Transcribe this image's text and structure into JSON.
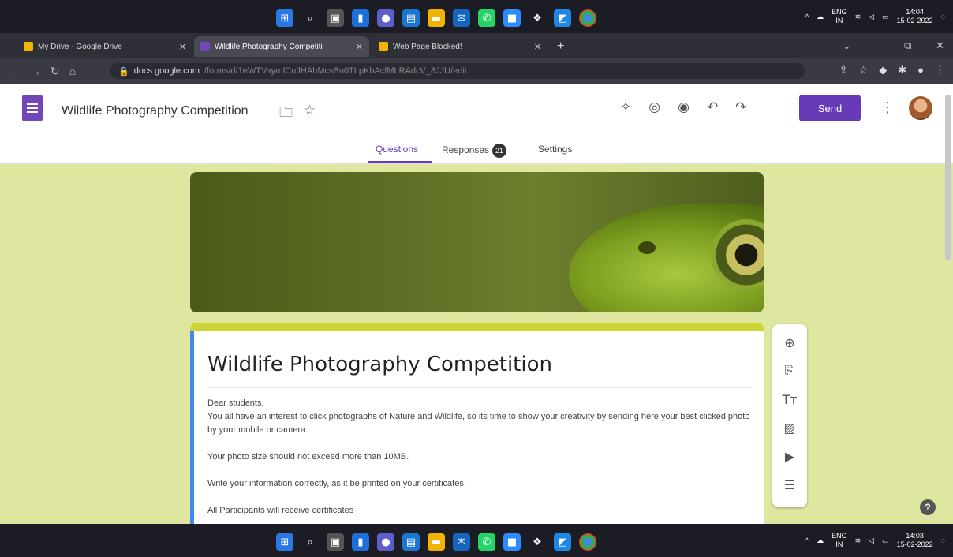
{
  "browser": {
    "tabs": [
      {
        "label": "My Drive - Google Drive",
        "color": "#f2b400"
      },
      {
        "label": "Wildlife Photography Competiti",
        "color": "#7248b9"
      },
      {
        "label": "Web Page Blocked!",
        "color": "#f2b400"
      }
    ],
    "url_host": "docs.google.com",
    "url_path": "/forms/d/1eWTVayrnlCuJHAhMcsBu0TLpKbAcfMLRAdcV_8JJU/edit"
  },
  "form_header": {
    "doc_title": "Wildlife Photography Competition",
    "send_label": "Send",
    "tabs": [
      "Questions",
      "Responses",
      "Settings"
    ],
    "responses_count": "21"
  },
  "form": {
    "title": "Wildlife Photography Competition",
    "description": [
      "Dear students,",
      "You all have an interest to click photographs of Nature and Wildlife, so its time to show your creativity by sending here your best clicked photo by your mobile or camera.",
      "Your photo size should not exceed more than 10MB.",
      "Write your information correctly, as it be printed on your certificates.",
      "All Participants will receive certificates"
    ]
  },
  "system_tray": {
    "lang": "ENG",
    "region": "IN",
    "time_top": "14:04",
    "date_top": "15-02-2022",
    "time_bottom": "14:03",
    "date_bottom": "15-02-2022"
  },
  "colors": {
    "accent": "#673ab7",
    "page_background": "#dfe6a0",
    "card_top_border": "#cdd635"
  }
}
